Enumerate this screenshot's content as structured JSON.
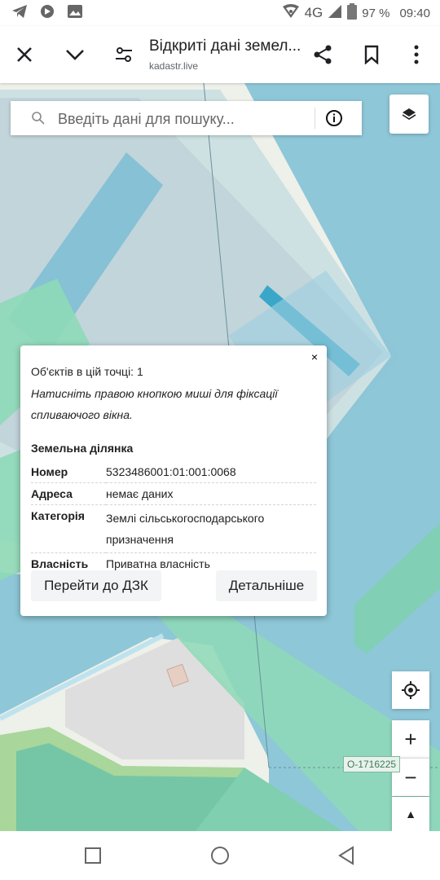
{
  "status_bar": {
    "network": "4G",
    "battery": "97 %",
    "time": "09:40"
  },
  "tab_bar": {
    "title": "Відкриті дані земел...",
    "url": "kadastr.live"
  },
  "search": {
    "placeholder": "Введіть дані для пошуку..."
  },
  "map": {
    "parcel_tag": "О-1716225"
  },
  "popup": {
    "close": "×",
    "objects_count": "Об'єктів в цій точці: 1",
    "hint": "Натисніть правою кнопкою миші для фіксації спливаючого вікна.",
    "heading": "Земельна ділянка",
    "rows": [
      {
        "key": "Номер",
        "value": "5323486001:01:001:0068"
      },
      {
        "key": "Адреса",
        "value": "немає даних"
      },
      {
        "key": "Категорія",
        "value": "Землі сільськогосподарського призначення"
      },
      {
        "key": "Власність",
        "value": "Приватна власність"
      }
    ],
    "btn_dzk": "Перейти до ДЗК",
    "btn_details": "Детальніше"
  },
  "controls": {
    "zoom_in": "+",
    "zoom_out": "−",
    "compass": "▲"
  },
  "colors": {
    "water": "#8ec7d8",
    "green": "#8ed9b7",
    "building": "#dcdcdc"
  }
}
